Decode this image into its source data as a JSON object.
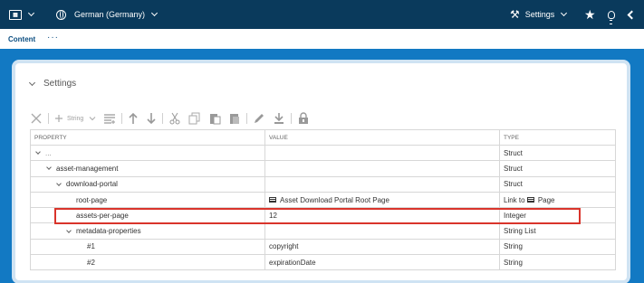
{
  "topbar": {
    "language": "German (Germany)",
    "settings_label": "Settings",
    "icons": [
      "app-switcher-icon",
      "globe-icon",
      "tools-icon",
      "star-icon",
      "lightbulb-icon",
      "back-icon"
    ]
  },
  "tabs": [
    {
      "label": "Content"
    }
  ],
  "panel": {
    "title": "Settings",
    "toolbar": {
      "add_label": "String"
    },
    "columns": {
      "property": "PROPERTY",
      "value": "VALUE",
      "type": "TYPE"
    },
    "rows": [
      {
        "property": "...",
        "value": "",
        "type": "Struct"
      },
      {
        "property": "asset-management",
        "value": "",
        "type": "Struct"
      },
      {
        "property": "download-portal",
        "value": "",
        "type": "Struct"
      },
      {
        "property": "root-page",
        "value": "Asset Download Portal Root Page",
        "type_prefix": "Link to",
        "type": "Page"
      },
      {
        "property": "assets-per-page",
        "value": "12",
        "type": "Integer"
      },
      {
        "property": "metadata-properties",
        "value": "",
        "type": "String List"
      },
      {
        "property": "#1",
        "value": "copyright",
        "type": "String"
      },
      {
        "property": "#2",
        "value": "expirationDate",
        "type": "String"
      }
    ]
  },
  "colors": {
    "topbar": "#0a3a5c",
    "workspace": "#1279c3",
    "highlight": "#d9342b"
  }
}
